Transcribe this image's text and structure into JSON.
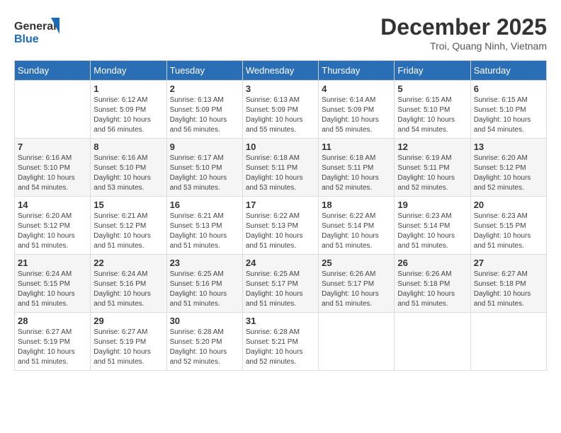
{
  "header": {
    "logo_general": "General",
    "logo_blue": "Blue",
    "month_title": "December 2025",
    "subtitle": "Troi, Quang Ninh, Vietnam"
  },
  "weekdays": [
    "Sunday",
    "Monday",
    "Tuesday",
    "Wednesday",
    "Thursday",
    "Friday",
    "Saturday"
  ],
  "weeks": [
    [
      {
        "day": "",
        "info": ""
      },
      {
        "day": "1",
        "info": "Sunrise: 6:12 AM\nSunset: 5:09 PM\nDaylight: 10 hours\nand 56 minutes."
      },
      {
        "day": "2",
        "info": "Sunrise: 6:13 AM\nSunset: 5:09 PM\nDaylight: 10 hours\nand 56 minutes."
      },
      {
        "day": "3",
        "info": "Sunrise: 6:13 AM\nSunset: 5:09 PM\nDaylight: 10 hours\nand 55 minutes."
      },
      {
        "day": "4",
        "info": "Sunrise: 6:14 AM\nSunset: 5:09 PM\nDaylight: 10 hours\nand 55 minutes."
      },
      {
        "day": "5",
        "info": "Sunrise: 6:15 AM\nSunset: 5:10 PM\nDaylight: 10 hours\nand 54 minutes."
      },
      {
        "day": "6",
        "info": "Sunrise: 6:15 AM\nSunset: 5:10 PM\nDaylight: 10 hours\nand 54 minutes."
      }
    ],
    [
      {
        "day": "7",
        "info": "Sunrise: 6:16 AM\nSunset: 5:10 PM\nDaylight: 10 hours\nand 54 minutes."
      },
      {
        "day": "8",
        "info": "Sunrise: 6:16 AM\nSunset: 5:10 PM\nDaylight: 10 hours\nand 53 minutes."
      },
      {
        "day": "9",
        "info": "Sunrise: 6:17 AM\nSunset: 5:10 PM\nDaylight: 10 hours\nand 53 minutes."
      },
      {
        "day": "10",
        "info": "Sunrise: 6:18 AM\nSunset: 5:11 PM\nDaylight: 10 hours\nand 53 minutes."
      },
      {
        "day": "11",
        "info": "Sunrise: 6:18 AM\nSunset: 5:11 PM\nDaylight: 10 hours\nand 52 minutes."
      },
      {
        "day": "12",
        "info": "Sunrise: 6:19 AM\nSunset: 5:11 PM\nDaylight: 10 hours\nand 52 minutes."
      },
      {
        "day": "13",
        "info": "Sunrise: 6:20 AM\nSunset: 5:12 PM\nDaylight: 10 hours\nand 52 minutes."
      }
    ],
    [
      {
        "day": "14",
        "info": "Sunrise: 6:20 AM\nSunset: 5:12 PM\nDaylight: 10 hours\nand 51 minutes."
      },
      {
        "day": "15",
        "info": "Sunrise: 6:21 AM\nSunset: 5:12 PM\nDaylight: 10 hours\nand 51 minutes."
      },
      {
        "day": "16",
        "info": "Sunrise: 6:21 AM\nSunset: 5:13 PM\nDaylight: 10 hours\nand 51 minutes."
      },
      {
        "day": "17",
        "info": "Sunrise: 6:22 AM\nSunset: 5:13 PM\nDaylight: 10 hours\nand 51 minutes."
      },
      {
        "day": "18",
        "info": "Sunrise: 6:22 AM\nSunset: 5:14 PM\nDaylight: 10 hours\nand 51 minutes."
      },
      {
        "day": "19",
        "info": "Sunrise: 6:23 AM\nSunset: 5:14 PM\nDaylight: 10 hours\nand 51 minutes."
      },
      {
        "day": "20",
        "info": "Sunrise: 6:23 AM\nSunset: 5:15 PM\nDaylight: 10 hours\nand 51 minutes."
      }
    ],
    [
      {
        "day": "21",
        "info": "Sunrise: 6:24 AM\nSunset: 5:15 PM\nDaylight: 10 hours\nand 51 minutes."
      },
      {
        "day": "22",
        "info": "Sunrise: 6:24 AM\nSunset: 5:16 PM\nDaylight: 10 hours\nand 51 minutes."
      },
      {
        "day": "23",
        "info": "Sunrise: 6:25 AM\nSunset: 5:16 PM\nDaylight: 10 hours\nand 51 minutes."
      },
      {
        "day": "24",
        "info": "Sunrise: 6:25 AM\nSunset: 5:17 PM\nDaylight: 10 hours\nand 51 minutes."
      },
      {
        "day": "25",
        "info": "Sunrise: 6:26 AM\nSunset: 5:17 PM\nDaylight: 10 hours\nand 51 minutes."
      },
      {
        "day": "26",
        "info": "Sunrise: 6:26 AM\nSunset: 5:18 PM\nDaylight: 10 hours\nand 51 minutes."
      },
      {
        "day": "27",
        "info": "Sunrise: 6:27 AM\nSunset: 5:18 PM\nDaylight: 10 hours\nand 51 minutes."
      }
    ],
    [
      {
        "day": "28",
        "info": "Sunrise: 6:27 AM\nSunset: 5:19 PM\nDaylight: 10 hours\nand 51 minutes."
      },
      {
        "day": "29",
        "info": "Sunrise: 6:27 AM\nSunset: 5:19 PM\nDaylight: 10 hours\nand 51 minutes."
      },
      {
        "day": "30",
        "info": "Sunrise: 6:28 AM\nSunset: 5:20 PM\nDaylight: 10 hours\nand 52 minutes."
      },
      {
        "day": "31",
        "info": "Sunrise: 6:28 AM\nSunset: 5:21 PM\nDaylight: 10 hours\nand 52 minutes."
      },
      {
        "day": "",
        "info": ""
      },
      {
        "day": "",
        "info": ""
      },
      {
        "day": "",
        "info": ""
      }
    ]
  ]
}
